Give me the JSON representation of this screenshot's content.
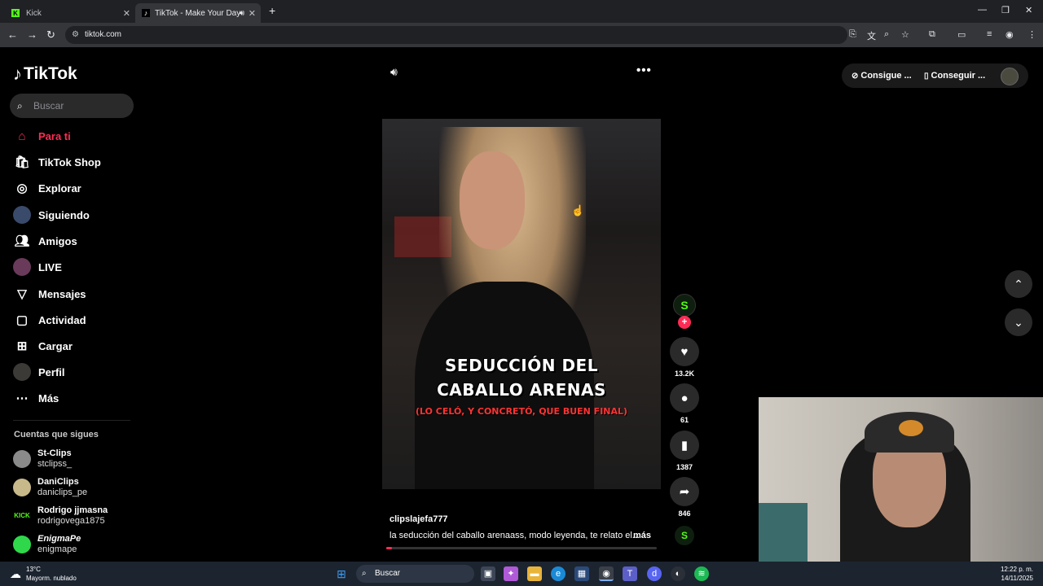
{
  "browser": {
    "tabs": [
      {
        "label": "Kick",
        "icon": "kick-favicon"
      },
      {
        "label": "TikTok - Make Your Day",
        "icon": "tiktok-favicon",
        "active": true
      }
    ],
    "url": "tiktok.com"
  },
  "sidebar": {
    "logo": "TikTok",
    "search_placeholder": "Buscar",
    "items": [
      {
        "label": "Para ti",
        "icon": "home-icon",
        "active": true
      },
      {
        "label": "TikTok Shop",
        "icon": "shop-icon"
      },
      {
        "label": "Explorar",
        "icon": "compass-icon"
      },
      {
        "label": "Siguiendo",
        "icon": "following-avatar"
      },
      {
        "label": "Amigos",
        "icon": "friends-icon"
      },
      {
        "label": "LIVE",
        "icon": "live-avatar"
      },
      {
        "label": "Mensajes",
        "icon": "send-icon"
      },
      {
        "label": "Actividad",
        "icon": "activity-icon"
      },
      {
        "label": "Cargar",
        "icon": "upload-icon"
      },
      {
        "label": "Perfil",
        "icon": "profile-avatar"
      },
      {
        "label": "Más",
        "icon": "more-icon"
      }
    ],
    "following_title": "Cuentas que sigues",
    "following": [
      {
        "name": "St-Clips",
        "handle": "stclipss_"
      },
      {
        "name": "DaniClips",
        "handle": "daniclips_pe"
      },
      {
        "name": "Rodrigo jjmasna",
        "handle": "rodrigovega1875"
      },
      {
        "name": "EnigmaPe",
        "handle": "enigmape"
      }
    ]
  },
  "topbar": {
    "get_coins": "Consigue ...",
    "get_app": "Conseguir ..."
  },
  "video": {
    "overlay_title_1": "SEDUCCIÓN DEL",
    "overlay_title_2": "CABALLO ARENAS",
    "overlay_subtitle": "(LO CELÓ, Y CONCRETÓ, QUE BUEN FINAL)",
    "username": "clipslajefa777",
    "caption": "la seducción del caballo arenaass, modo leyenda, te relato el...",
    "more": "más",
    "progress_percent": 2,
    "likes": "13.2K",
    "comments": "61",
    "saves": "1387",
    "shares": "846"
  },
  "taskbar": {
    "temp": "13°C",
    "weather": "Mayorm. nublado",
    "search": "Buscar",
    "time": "12:22 p. m.",
    "date": "14/11/2025"
  }
}
